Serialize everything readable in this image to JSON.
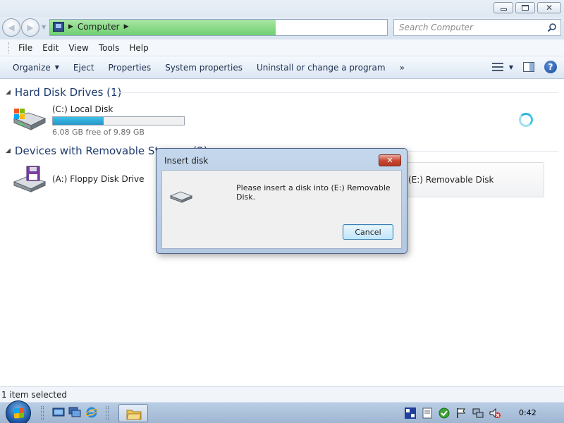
{
  "window": {
    "caption_buttons": [
      "minimize",
      "maximize",
      "close"
    ]
  },
  "address": {
    "crumbs": [
      "Computer"
    ],
    "progress_percent": 67,
    "search_placeholder": "Search Computer"
  },
  "menu": {
    "items": [
      "File",
      "Edit",
      "View",
      "Tools",
      "Help"
    ]
  },
  "commands": {
    "organize": "Organize",
    "eject": "Eject",
    "properties": "Properties",
    "system_properties": "System properties",
    "uninstall": "Uninstall or change a program",
    "more": "»"
  },
  "groups": {
    "hard_disks": {
      "title": "Hard Disk Drives (1)",
      "drives": [
        {
          "label": "(C:) Local Disk",
          "free_text": "6.08 GB free of 9.89 GB",
          "used_fraction": 0.385
        }
      ]
    },
    "removable": {
      "title": "Devices with Removable Storage (2)",
      "drives": [
        {
          "label": "(A:) Floppy Disk Drive"
        },
        {
          "label": "(E:) Removable Disk"
        }
      ]
    }
  },
  "dialog": {
    "title": "Insert disk",
    "message": "Please insert a disk into (E:) Removable Disk.",
    "cancel_label": "Cancel"
  },
  "status": {
    "text": "1 item selected"
  },
  "taskbar": {
    "clock": "0:42"
  },
  "colors": {
    "capacity_fill": "#2ea6d6",
    "progress_green": "#6fd071",
    "group_title": "#1e3b6e"
  }
}
